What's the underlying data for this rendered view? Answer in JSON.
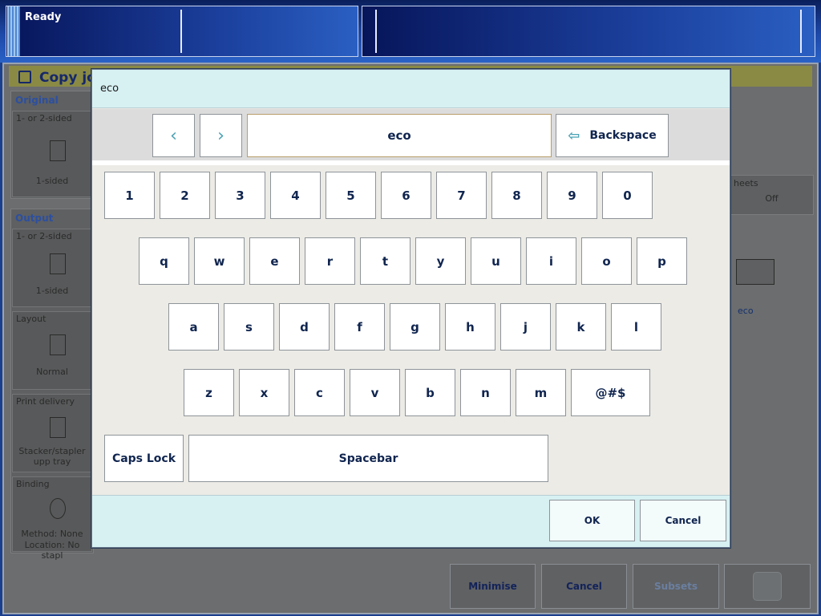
{
  "status": {
    "text": "Ready"
  },
  "background": {
    "title": "Copy jol",
    "original": {
      "title": "Original",
      "sides_label": "1- or 2-sided",
      "sides_value": "1-sided"
    },
    "output": {
      "title": "Output",
      "sides_label": "1- or 2-sided",
      "sides_value": "1-sided",
      "layout_label": "Layout",
      "layout_value": "Normal",
      "delivery_label": "Print delivery",
      "delivery_value": "Stacker/stapler upp tray",
      "binding_label": "Binding",
      "binding_value_1": "Method: None",
      "binding_value_2": "Location: No stapl"
    },
    "right": {
      "sheets_label": "heets",
      "sheets_value": "Off",
      "eco_label": "eco"
    },
    "bottom": {
      "minimise": "Minimise",
      "cancel": "Cancel",
      "subsets": "Subsets"
    }
  },
  "dialog": {
    "title": "eco",
    "field_value": "eco",
    "nav_prev": "‹",
    "nav_next": "›",
    "backspace": "Backspace",
    "rows": [
      [
        "1",
        "2",
        "3",
        "4",
        "5",
        "6",
        "7",
        "8",
        "9",
        "0"
      ],
      [
        "q",
        "w",
        "e",
        "r",
        "t",
        "y",
        "u",
        "i",
        "o",
        "p"
      ],
      [
        "a",
        "s",
        "d",
        "f",
        "g",
        "h",
        "j",
        "k",
        "l"
      ],
      [
        "z",
        "x",
        "c",
        "v",
        "b",
        "n",
        "m"
      ]
    ],
    "symbols_key": "@#$",
    "caps_lock": "Caps Lock",
    "spacebar": "Spacebar",
    "ok": "OK",
    "cancel": "Cancel"
  }
}
